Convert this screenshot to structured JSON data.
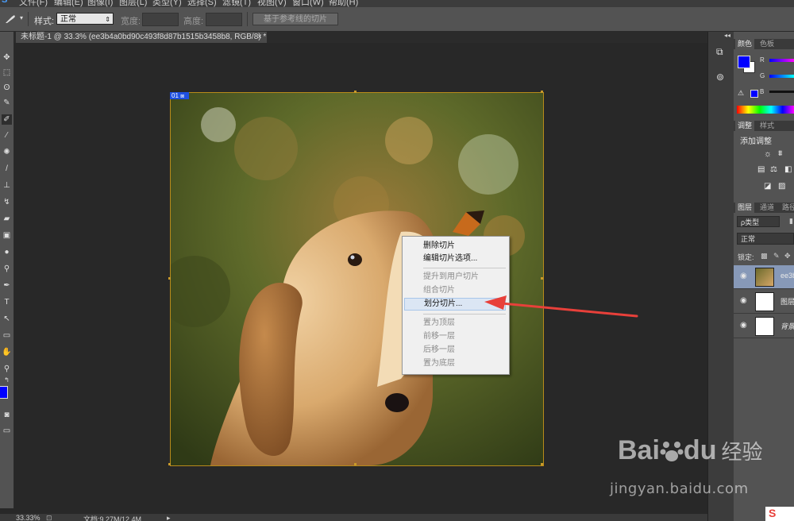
{
  "menubar": {
    "items": [
      "文件(F)",
      "编辑(E)",
      "图像(I)",
      "图层(L)",
      "类型(Y)",
      "选择(S)",
      "滤镜(T)",
      "视图(V)",
      "窗口(W)",
      "帮助(H)"
    ]
  },
  "options_bar": {
    "tool_icon": "slice-tool-icon",
    "style_label": "样式:",
    "style_value": "正常",
    "width_label": "宽度:",
    "height_label": "高度:",
    "guide_button_label": "基于参考线的切片"
  },
  "document": {
    "tab_title": "未标题-1 @ 33.3% (ee3b4a0bd90c493f8d87b1515b3458b8, RGB/8) *",
    "close_glyph": "×",
    "slice_badge": "01"
  },
  "context_menu": {
    "items": [
      {
        "label": "删除切片",
        "enabled": true
      },
      {
        "label": "编辑切片选项...",
        "enabled": true
      },
      {
        "label": "提升到用户切片",
        "enabled": false
      },
      {
        "label": "组合切片",
        "enabled": false
      },
      {
        "label": "划分切片...",
        "enabled": true,
        "highlighted": true
      },
      {
        "label": "置为顶层",
        "enabled": false
      },
      {
        "label": "前移一层",
        "enabled": false
      },
      {
        "label": "后移一层",
        "enabled": false
      },
      {
        "label": "置为底层",
        "enabled": false
      }
    ]
  },
  "statusbar": {
    "zoom": "33.33%",
    "doc_size": "文档:9.27M/12.4M"
  },
  "panels": {
    "color_tabs": [
      "颜色",
      "色板"
    ],
    "channels": [
      "R",
      "G",
      "B"
    ],
    "foreground_color": "#0000ff",
    "background_color": "#ffffff",
    "adjust_tabs": [
      "调整",
      "样式"
    ],
    "adjust_title": "添加调整",
    "layer_tabs": [
      "图层",
      "通道",
      "路径"
    ],
    "layer_filter": "ρ类型",
    "blend_mode": "正常",
    "lock_label": "锁定:",
    "layers": [
      {
        "name": "ee3b",
        "selected": true
      },
      {
        "name": "图层",
        "selected": false
      },
      {
        "name": "背景",
        "selected": false
      }
    ]
  },
  "watermark": {
    "brand": "Bai",
    "brand_suffix": "du",
    "brand_cn": "经验",
    "url": "jingyan.baidu.com"
  },
  "colors": {
    "accent_arrow": "#e8403a",
    "slice_border": "#b88a1a",
    "menu_highlight": "#dbe6f4"
  }
}
